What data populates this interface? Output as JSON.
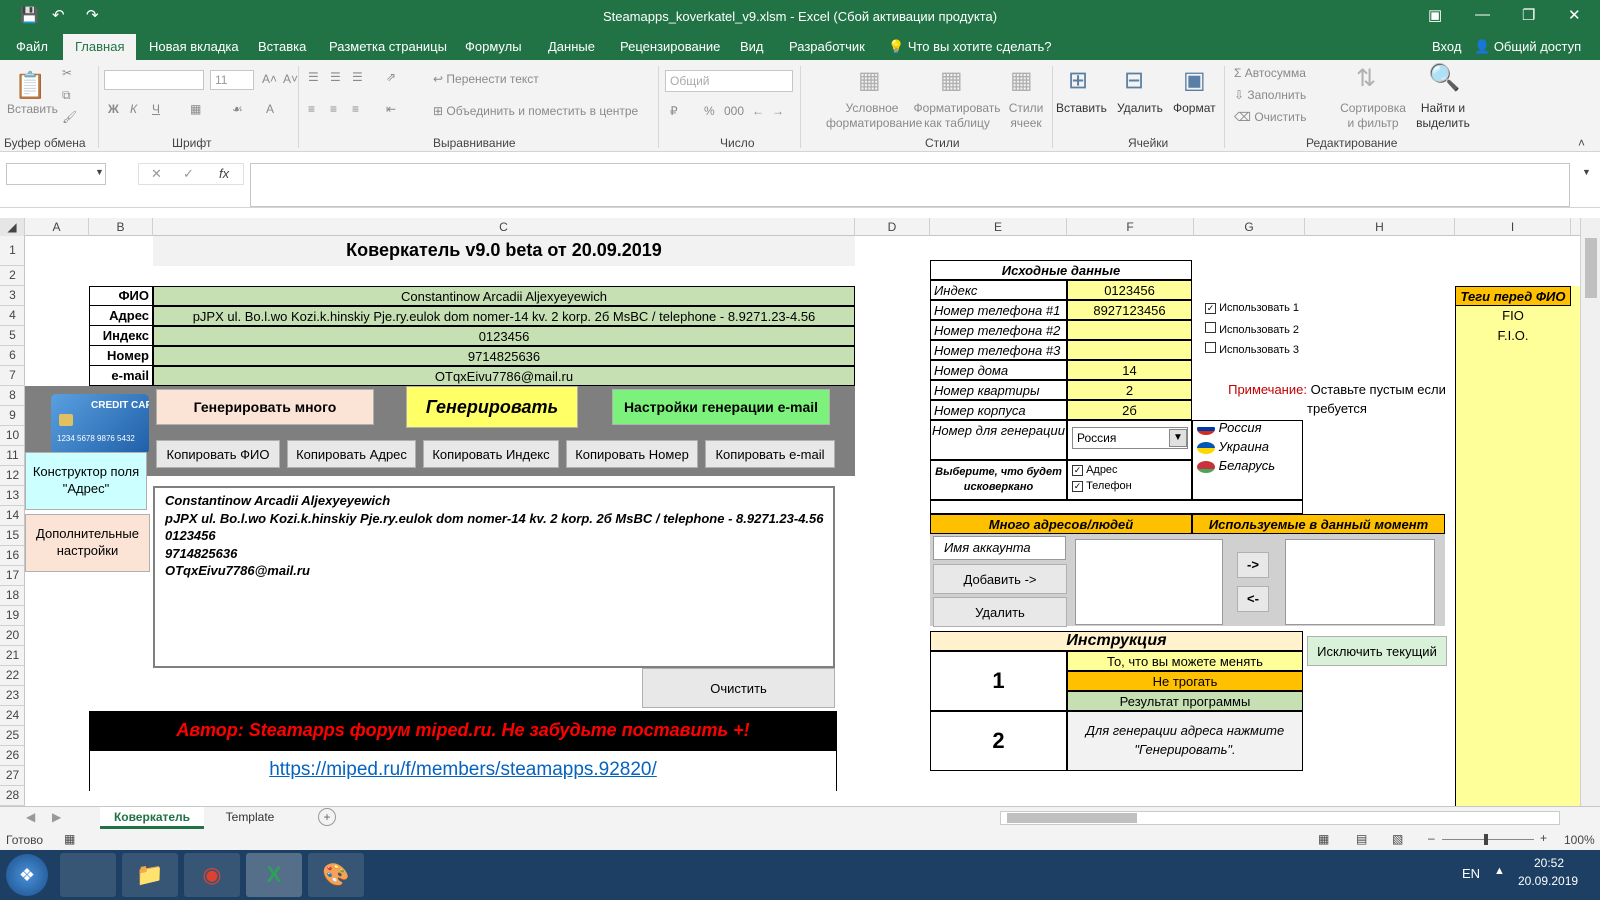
{
  "window": {
    "title": "Steamapps_koverkatel_v9.xlsm - Excel (Сбой активации продукта)"
  },
  "menu": {
    "file": "Файл",
    "home": "Главная",
    "new_tab": "Новая вкладка",
    "insert": "Вставка",
    "layout": "Разметка страницы",
    "formulas": "Формулы",
    "data": "Данные",
    "review": "Рецензирование",
    "view": "Вид",
    "developer": "Разработчик",
    "tell": "Что вы хотите сделать?",
    "signin": "Вход",
    "share": "Общий доступ"
  },
  "ribbon": {
    "paste": "Вставить",
    "clip_group": "Буфер обмена",
    "font_group": "Шрифт",
    "font_size": "11",
    "wrap": "Перенести текст",
    "merge": "Объединить и поместить в центре",
    "align_group": "Выравнивание",
    "number_format": "Общий",
    "number_group": "Число",
    "cond": "Условное форматирование",
    "astable": "Форматировать как таблицу",
    "cellstyles": "Стили ячеек",
    "styles_group": "Стили",
    "ins": "Вставить",
    "del": "Удалить",
    "fmt": "Формат",
    "cells_group": "Ячейки",
    "autosum": "Автосумма",
    "fill": "Заполнить",
    "clear": "Очистить",
    "sort": "Сортировка и фильтр",
    "find": "Найти и выделить",
    "edit_group": "Редактирование",
    "bold": "Ж",
    "italic": "К",
    "underline": "Ч",
    "percent": "%",
    "thousands": "000"
  },
  "columns": [
    "A",
    "B",
    "C",
    "D",
    "E",
    "F",
    "G",
    "H",
    "I"
  ],
  "rows": [
    "1",
    "2",
    "3",
    "4",
    "5",
    "6",
    "7",
    "8",
    "9",
    "10",
    "11",
    "12",
    "13",
    "14",
    "15",
    "16",
    "17",
    "18",
    "19",
    "20",
    "21",
    "22",
    "23",
    "24",
    "25",
    "26",
    "27",
    "28"
  ],
  "sheet": {
    "title": "Коверкатель v9.0 beta от 20.09.2019",
    "labels": {
      "fio": "ФИО",
      "addr": "Адрес",
      "index": "Индекс",
      "num": "Номер",
      "email": "e-mail"
    },
    "values": {
      "fio": "Constantinow Arcadii Aljexyeyewich",
      "addr": "pJPX ul. Bo.l.wo  Kozi.k.hinskiy  Pje.ry.eulok dom nomer-14 kv. 2 korp. 2б MsBC  / telephone - 8.9271.23-4.56",
      "index": "0123456",
      "num": "9714825636",
      "email": "OTqxEivu7786@mail.ru"
    },
    "card_text": "CREDIT CARD",
    "card_number": "1234 5678 9876 5432",
    "btn_gen_many": "Генерировать много",
    "btn_gen": "Генерировать",
    "btn_email_settings": "Настройки генерации e-mail",
    "btn_copy_fio": "Копировать ФИО",
    "btn_copy_addr": "Копировать Адрес",
    "btn_copy_index": "Копировать Индекс",
    "btn_copy_num": "Копировать Номер",
    "btn_copy_email": "Копировать e-mail",
    "btn_constructor": "Конструктор поля \"Адрес\"",
    "btn_extra": "Дополнительные настройки",
    "output": [
      "Constantinow Arcadii Aljexyeyewich",
      "pJPX ul. Bo.l.wo  Kozi.k.hinskiy  Pje.ry.eulok dom nomer-14 kv. 2 korp. 2б MsBC  / telephone - 8.9271.23-4.56",
      "0123456",
      "9714825636",
      "OTqxEivu7786@mail.ru"
    ],
    "btn_clear": "Очистить",
    "author": "Автор: Steamapps форум miped.ru. Не забудьте поставить +!",
    "link": "https://miped.ru/f/members/steamapps.92820/",
    "src_title": "Исходные данные",
    "src_rows": [
      {
        "label": "Индекс",
        "value": "0123456"
      },
      {
        "label": "Номер телефона #1",
        "value": "8927123456"
      },
      {
        "label": "Номер телефона #2",
        "value": ""
      },
      {
        "label": "Номер телефона #3",
        "value": ""
      },
      {
        "label": "Номер дома",
        "value": "14"
      },
      {
        "label": "Номер квартиры",
        "value": "2"
      },
      {
        "label": "Номер корпуса",
        "value": "2б"
      }
    ],
    "use1": "Использовать 1",
    "use2": "Использовать 2",
    "use3": "Использовать 3",
    "note_label": "Примечание:",
    "note_text": "Оставьте пустым если требуется",
    "gen_num_label": "Номер для генерации",
    "country": "Россия",
    "countries": [
      "Россия",
      "Украина",
      "Беларусь"
    ],
    "choose_label": "Выберите, что будет исковеркано",
    "chk_addr": "Адрес",
    "chk_phone": "Телефон",
    "many_title": "Много адресов/людей",
    "used_title": "Используемые в данный момент",
    "account_placeholder": "Имя аккаунта",
    "btn_add": "Добавить ->",
    "btn_remove": "Удалить",
    "btn_right": "->",
    "btn_left": "<-",
    "instr_title": "Инструкция",
    "btn_exclude": "Исключить текущий",
    "instr1_num": "1",
    "instr1_a": "То, что вы можете менять",
    "instr1_b": "Не трогать",
    "instr1_c": "Результат программы",
    "instr2_num": "2",
    "instr2_text": "Для генерации адреса нажмите \"Генерировать\".",
    "tags_title": "Теги перед ФИО",
    "tag1": "FIO",
    "tag2": "F.I.O."
  },
  "tabs": {
    "tab1": "Коверкатель",
    "tab2": "Template"
  },
  "status": {
    "ready": "Готово",
    "zoom": "100%"
  },
  "taskbar": {
    "lang": "EN",
    "time": "20:52",
    "date": "20.09.2019"
  }
}
